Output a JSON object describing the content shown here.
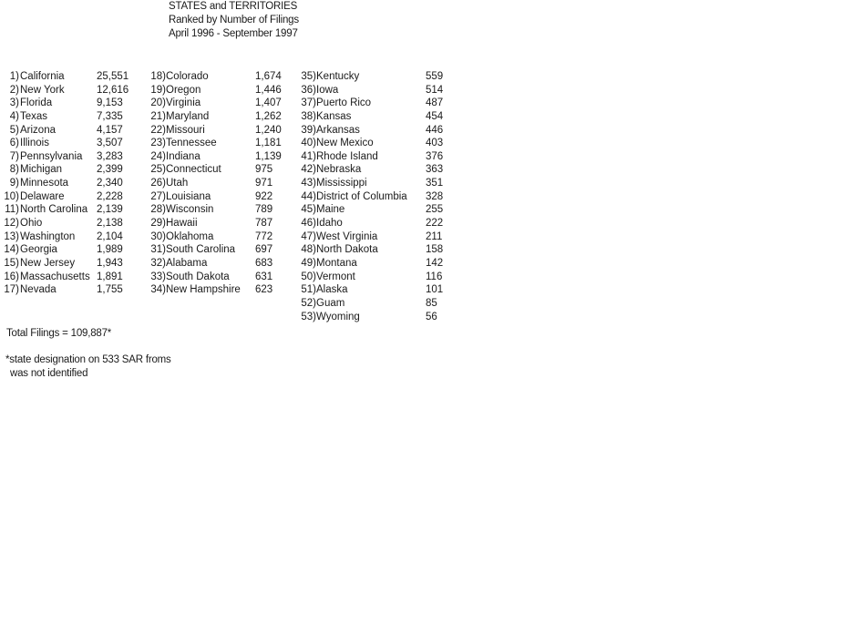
{
  "header": {
    "line1": "STATES and TERRITORIES",
    "line2": "Ranked by Number of Filings",
    "line3": "April 1996 - September 1997"
  },
  "columns": [
    [
      {
        "rank": "1)",
        "name": "California",
        "value": "25,551"
      },
      {
        "rank": "2)",
        "name": "New York",
        "value": "12,616"
      },
      {
        "rank": "3)",
        "name": "Florida",
        "value": "9,153"
      },
      {
        "rank": "4)",
        "name": "Texas",
        "value": "7,335"
      },
      {
        "rank": "5)",
        "name": "Arizona",
        "value": "4,157"
      },
      {
        "rank": "6)",
        "name": "Illinois",
        "value": "3,507"
      },
      {
        "rank": "7)",
        "name": "Pennsylvania",
        "value": "3,283"
      },
      {
        "rank": "8)",
        "name": "Michigan",
        "value": "2,399"
      },
      {
        "rank": "9)",
        "name": "Minnesota",
        "value": "2,340"
      },
      {
        "rank": "10)",
        "name": "Delaware",
        "value": "2,228"
      },
      {
        "rank": "11)",
        "name": "North Carolina",
        "value": "2,139"
      },
      {
        "rank": "12)",
        "name": "Ohio",
        "value": "2,138"
      },
      {
        "rank": "13)",
        "name": "Washington",
        "value": "2,104"
      },
      {
        "rank": "14)",
        "name": "Georgia",
        "value": "1,989"
      },
      {
        "rank": "15)",
        "name": "New Jersey",
        "value": "1,943"
      },
      {
        "rank": "16)",
        "name": "Massachusetts",
        "value": "1,891"
      },
      {
        "rank": "17)",
        "name": "Nevada",
        "value": "1,755"
      }
    ],
    [
      {
        "rank": "18)",
        "name": "Colorado",
        "value": "1,674"
      },
      {
        "rank": "19)",
        "name": "Oregon",
        "value": "1,446"
      },
      {
        "rank": "20)",
        "name": "Virginia",
        "value": "1,407"
      },
      {
        "rank": "21)",
        "name": "Maryland",
        "value": "1,262"
      },
      {
        "rank": "22)",
        "name": "Missouri",
        "value": "1,240"
      },
      {
        "rank": "23)",
        "name": "Tennessee",
        "value": "1,181"
      },
      {
        "rank": "24)",
        "name": "Indiana",
        "value": "1,139"
      },
      {
        "rank": "25)",
        "name": "Connecticut",
        "value": "975"
      },
      {
        "rank": "26)",
        "name": "Utah",
        "value": "971"
      },
      {
        "rank": "27)",
        "name": "Louisiana",
        "value": "922"
      },
      {
        "rank": "28)",
        "name": "Wisconsin",
        "value": "789"
      },
      {
        "rank": "29)",
        "name": "Hawaii",
        "value": "787"
      },
      {
        "rank": "30)",
        "name": "Oklahoma",
        "value": "772"
      },
      {
        "rank": "31)",
        "name": "South Carolina",
        "value": "697"
      },
      {
        "rank": "32)",
        "name": "Alabama",
        "value": "683"
      },
      {
        "rank": "33)",
        "name": "South Dakota",
        "value": "631"
      },
      {
        "rank": "34)",
        "name": "New Hampshire",
        "value": "623"
      }
    ],
    [
      {
        "rank": "35)",
        "name": "Kentucky",
        "value": "559"
      },
      {
        "rank": "36)",
        "name": "Iowa",
        "value": "514"
      },
      {
        "rank": "37)",
        "name": "Puerto Rico",
        "value": "487"
      },
      {
        "rank": "38)",
        "name": "Kansas",
        "value": "454"
      },
      {
        "rank": "39)",
        "name": "Arkansas",
        "value": "446"
      },
      {
        "rank": "40)",
        "name": "New Mexico",
        "value": "403"
      },
      {
        "rank": "41)",
        "name": "Rhode Island",
        "value": "376"
      },
      {
        "rank": "42)",
        "name": "Nebraska",
        "value": "363"
      },
      {
        "rank": "43)",
        "name": "Mississippi",
        "value": "351"
      },
      {
        "rank": "44)",
        "name": "District of Columbia",
        "value": "328"
      },
      {
        "rank": "45)",
        "name": "Maine",
        "value": "255"
      },
      {
        "rank": "46)",
        "name": "Idaho",
        "value": "222"
      },
      {
        "rank": "47)",
        "name": "West Virginia",
        "value": "211"
      },
      {
        "rank": "48)",
        "name": "North Dakota",
        "value": "158"
      },
      {
        "rank": "49)",
        "name": "Montana",
        "value": "142"
      },
      {
        "rank": "50)",
        "name": "Vermont",
        "value": "116"
      },
      {
        "rank": "51)",
        "name": "Alaska",
        "value": "101"
      },
      {
        "rank": "52)",
        "name": "Guam",
        "value": "85"
      },
      {
        "rank": "53)",
        "name": "Wyoming",
        "value": "56"
      }
    ]
  ],
  "footer": {
    "total": "Total Filings = 109,887*",
    "note_line1": "*state designation on 533 SAR froms",
    "note_line2": "was not identified"
  }
}
